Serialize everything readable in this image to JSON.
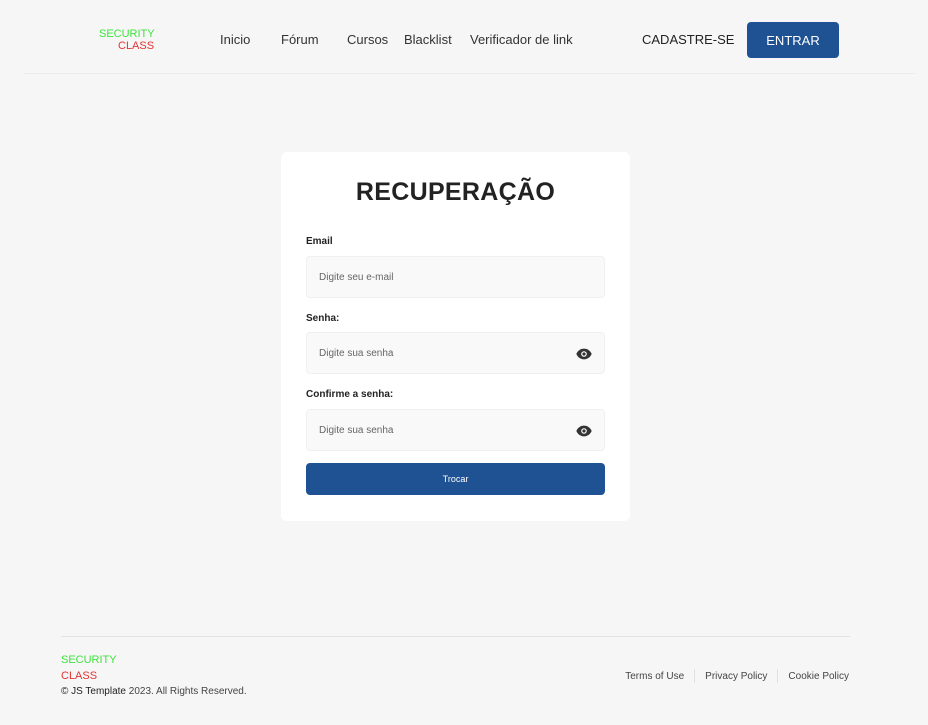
{
  "header": {
    "logo_line1": "SECURITY",
    "logo_line2": "CLASS",
    "nav": [
      {
        "label": "Inicio"
      },
      {
        "label": "Fórum"
      },
      {
        "label": "Cursos"
      },
      {
        "label": "Blacklist"
      },
      {
        "label": "Verificador de link"
      }
    ],
    "signup_label": "CADASTRE-SE",
    "login_label": "ENTRAR"
  },
  "form": {
    "title": "RECUPERAÇÃO",
    "email": {
      "label": "Email",
      "placeholder": "Digite seu e-mail",
      "value": ""
    },
    "password": {
      "label": "Senha:",
      "placeholder": "Digite sua senha",
      "value": ""
    },
    "confirm": {
      "label": "Confirme a senha:",
      "placeholder": "Digite sua senha",
      "value": ""
    },
    "submit_label": "Trocar"
  },
  "footer": {
    "logo_line1": "SECURITY",
    "logo_line2": "CLASS",
    "copyright_brand": "© JS Template",
    "copyright_rest": " 2023. All Rights Reserved.",
    "links": [
      {
        "label": "Terms of Use"
      },
      {
        "label": "Privacy Policy"
      },
      {
        "label": "Cookie Policy"
      }
    ]
  },
  "colors": {
    "primary": "#1e5293",
    "logo_green": "#3ee33e",
    "logo_red": "#e53232",
    "background": "#f6f6f6"
  },
  "icons": {
    "password_toggle": "eye-icon",
    "confirm_toggle": "eye-icon"
  }
}
